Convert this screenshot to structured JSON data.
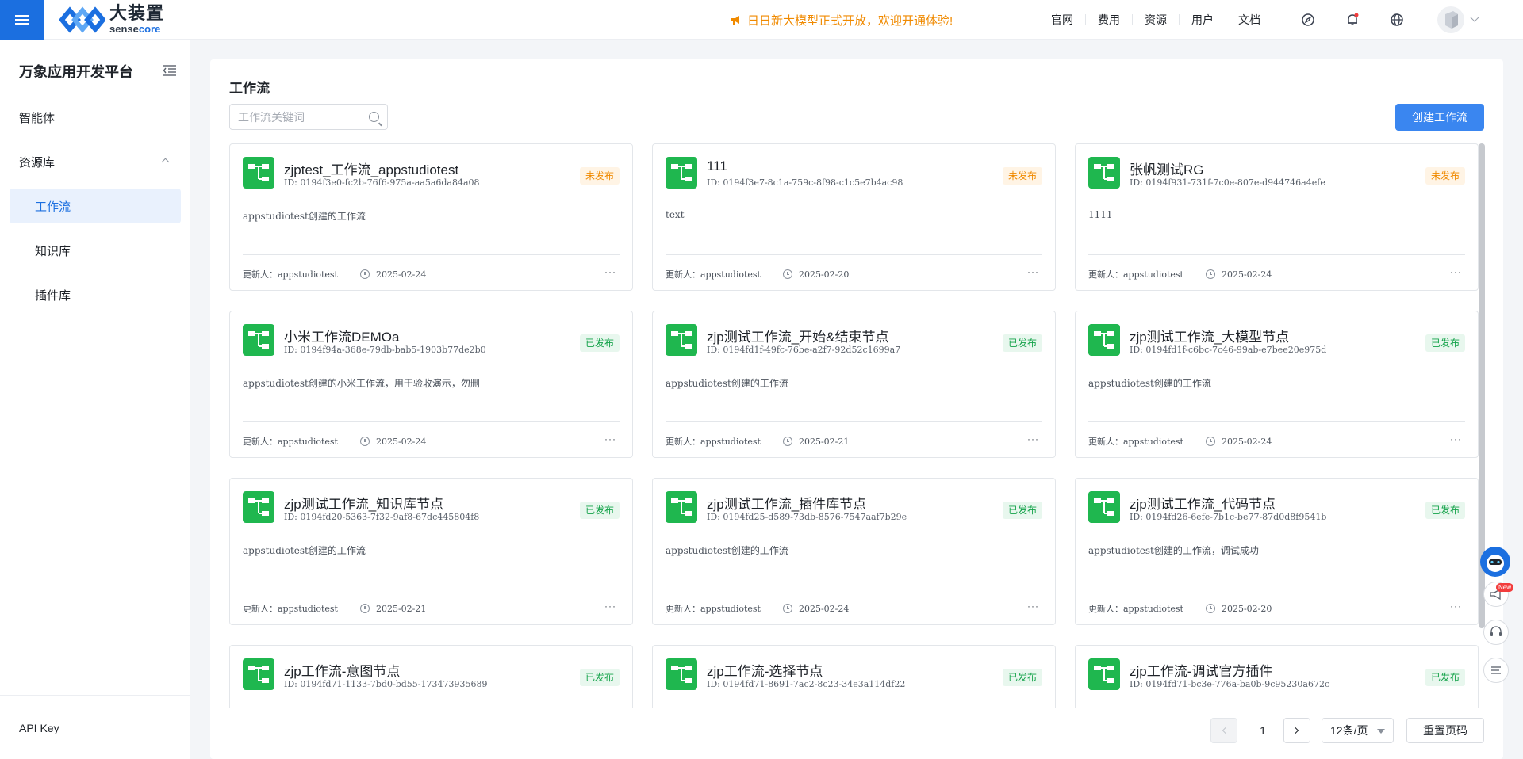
{
  "header": {
    "brand_cn": "大装置",
    "brand_en_a": "sense",
    "brand_en_b": "core",
    "notice": "日日新大模型正式开放，欢迎开通体验!",
    "links": [
      "官网",
      "费用",
      "资源",
      "用户",
      "文档"
    ],
    "icons": [
      "compass-icon",
      "bell-icon",
      "globe-icon"
    ],
    "accent_color": "#1b6fe0",
    "notice_color": "#f08a00"
  },
  "sidebar": {
    "title": "万象应用开发平台",
    "items": [
      {
        "label": "智能体"
      },
      {
        "label": "资源库"
      },
      {
        "label": "工作流"
      },
      {
        "label": "知识库"
      },
      {
        "label": "插件库"
      }
    ],
    "footer_label": "API Key"
  },
  "main": {
    "title": "工作流",
    "search_placeholder": "工作流关键词",
    "create_label": "创建工作流",
    "updater_prefix": "更新人：",
    "more_label": "···",
    "cards": [
      {
        "name": "zjptest_工作流_appstudiotest",
        "id": "ID: 0194f3e0-fc2b-76f6-975a-aa5a6da84a08",
        "status": "未发布",
        "desc": "appstudiotest创建的工作流",
        "updater": "appstudiotest",
        "date": "2025-02-24"
      },
      {
        "name": "111",
        "id": "ID: 0194f3e7-8c1a-759c-8f98-c1c5e7b4ac98",
        "status": "未发布",
        "desc": "text",
        "updater": "appstudiotest",
        "date": "2025-02-20"
      },
      {
        "name": "张帆测试RG",
        "id": "ID: 0194f931-731f-7c0e-807e-d944746a4efe",
        "status": "未发布",
        "desc": "1111",
        "updater": "appstudiotest",
        "date": "2025-02-24"
      },
      {
        "name": "小米工作流DEMOa",
        "id": "ID: 0194f94a-368e-79db-bab5-1903b77de2b0",
        "status": "已发布",
        "desc": "appstudiotest创建的小米工作流，用于验收演示，勿删",
        "updater": "appstudiotest",
        "date": "2025-02-24"
      },
      {
        "name": "zjp测试工作流_开始&结束节点",
        "id": "ID: 0194fd1f-49fc-76be-a2f7-92d52c1699a7",
        "status": "已发布",
        "desc": "appstudiotest创建的工作流",
        "updater": "appstudiotest",
        "date": "2025-02-21"
      },
      {
        "name": "zjp测试工作流_大模型节点",
        "id": "ID: 0194fd1f-c6bc-7c46-99ab-e7bee20e975d",
        "status": "已发布",
        "desc": "appstudiotest创建的工作流",
        "updater": "appstudiotest",
        "date": "2025-02-24"
      },
      {
        "name": "zjp测试工作流_知识库节点",
        "id": "ID: 0194fd20-5363-7f32-9af8-67dc445804f8",
        "status": "已发布",
        "desc": "appstudiotest创建的工作流",
        "updater": "appstudiotest",
        "date": "2025-02-21"
      },
      {
        "name": "zjp测试工作流_插件库节点",
        "id": "ID: 0194fd25-d589-73db-8576-7547aaf7b29e",
        "status": "已发布",
        "desc": "appstudiotest创建的工作流",
        "updater": "appstudiotest",
        "date": "2025-02-24"
      },
      {
        "name": "zjp测试工作流_代码节点",
        "id": "ID: 0194fd26-6efe-7b1c-be77-87d0d8f9541b",
        "status": "已发布",
        "desc": "appstudiotest创建的工作流，调试成功",
        "updater": "appstudiotest",
        "date": "2025-02-20"
      },
      {
        "name": "zjp工作流-意图节点",
        "id": "ID: 0194fd71-1133-7bd0-bd55-173473935689",
        "status": "已发布",
        "desc": "",
        "updater": "",
        "date": ""
      },
      {
        "name": "zjp工作流-选择节点",
        "id": "ID: 0194fd71-8691-7ac2-8c23-34e3a114df22",
        "status": "已发布",
        "desc": "",
        "updater": "",
        "date": ""
      },
      {
        "name": "zjp工作流-调试官方插件",
        "id": "ID: 0194fd71-bc3e-776a-ba0b-9c95230a672c",
        "status": "已发布",
        "desc": "",
        "updater": "",
        "date": ""
      }
    ],
    "status_colors": {
      "未发布": "#f08a00",
      "已发布": "#14a34a"
    }
  },
  "pagination": {
    "current_page": "1",
    "page_size": "12条/页",
    "reset_label": "重置页码"
  },
  "float_tools": {
    "new_badge": "New"
  }
}
